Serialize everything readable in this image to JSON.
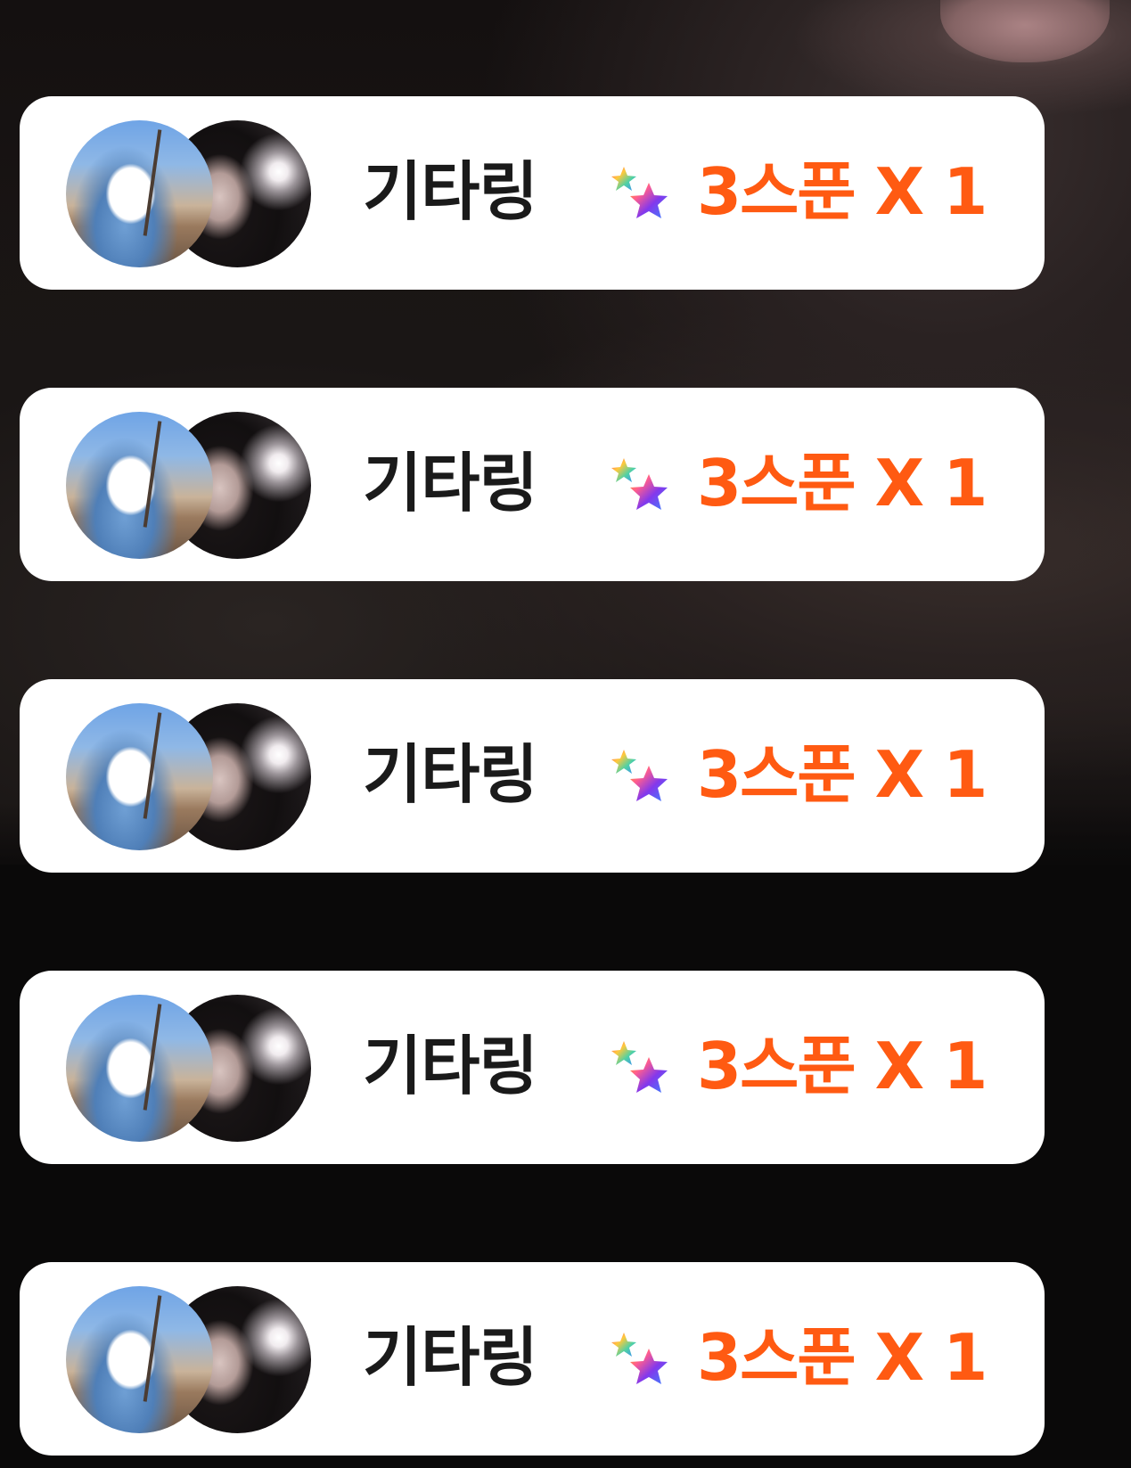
{
  "theme": {
    "card_bg": "#ffffff",
    "name_color": "#1a1a1a",
    "gift_color": "#ff5a12"
  },
  "notifications": [
    {
      "sender_name": "기타링",
      "gift_name": "3스푼",
      "multiplier": "X 1",
      "icon": "rainbow-stars-icon"
    },
    {
      "sender_name": "기타링",
      "gift_name": "3스푼",
      "multiplier": "X 1",
      "icon": "rainbow-stars-icon"
    },
    {
      "sender_name": "기타링",
      "gift_name": "3스푼",
      "multiplier": "X 1",
      "icon": "rainbow-stars-icon"
    },
    {
      "sender_name": "기타링",
      "gift_name": "3스푼",
      "multiplier": "X 1",
      "icon": "rainbow-stars-icon"
    },
    {
      "sender_name": "기타링",
      "gift_name": "3스푼",
      "multiplier": "X 1",
      "icon": "rainbow-stars-icon"
    }
  ]
}
